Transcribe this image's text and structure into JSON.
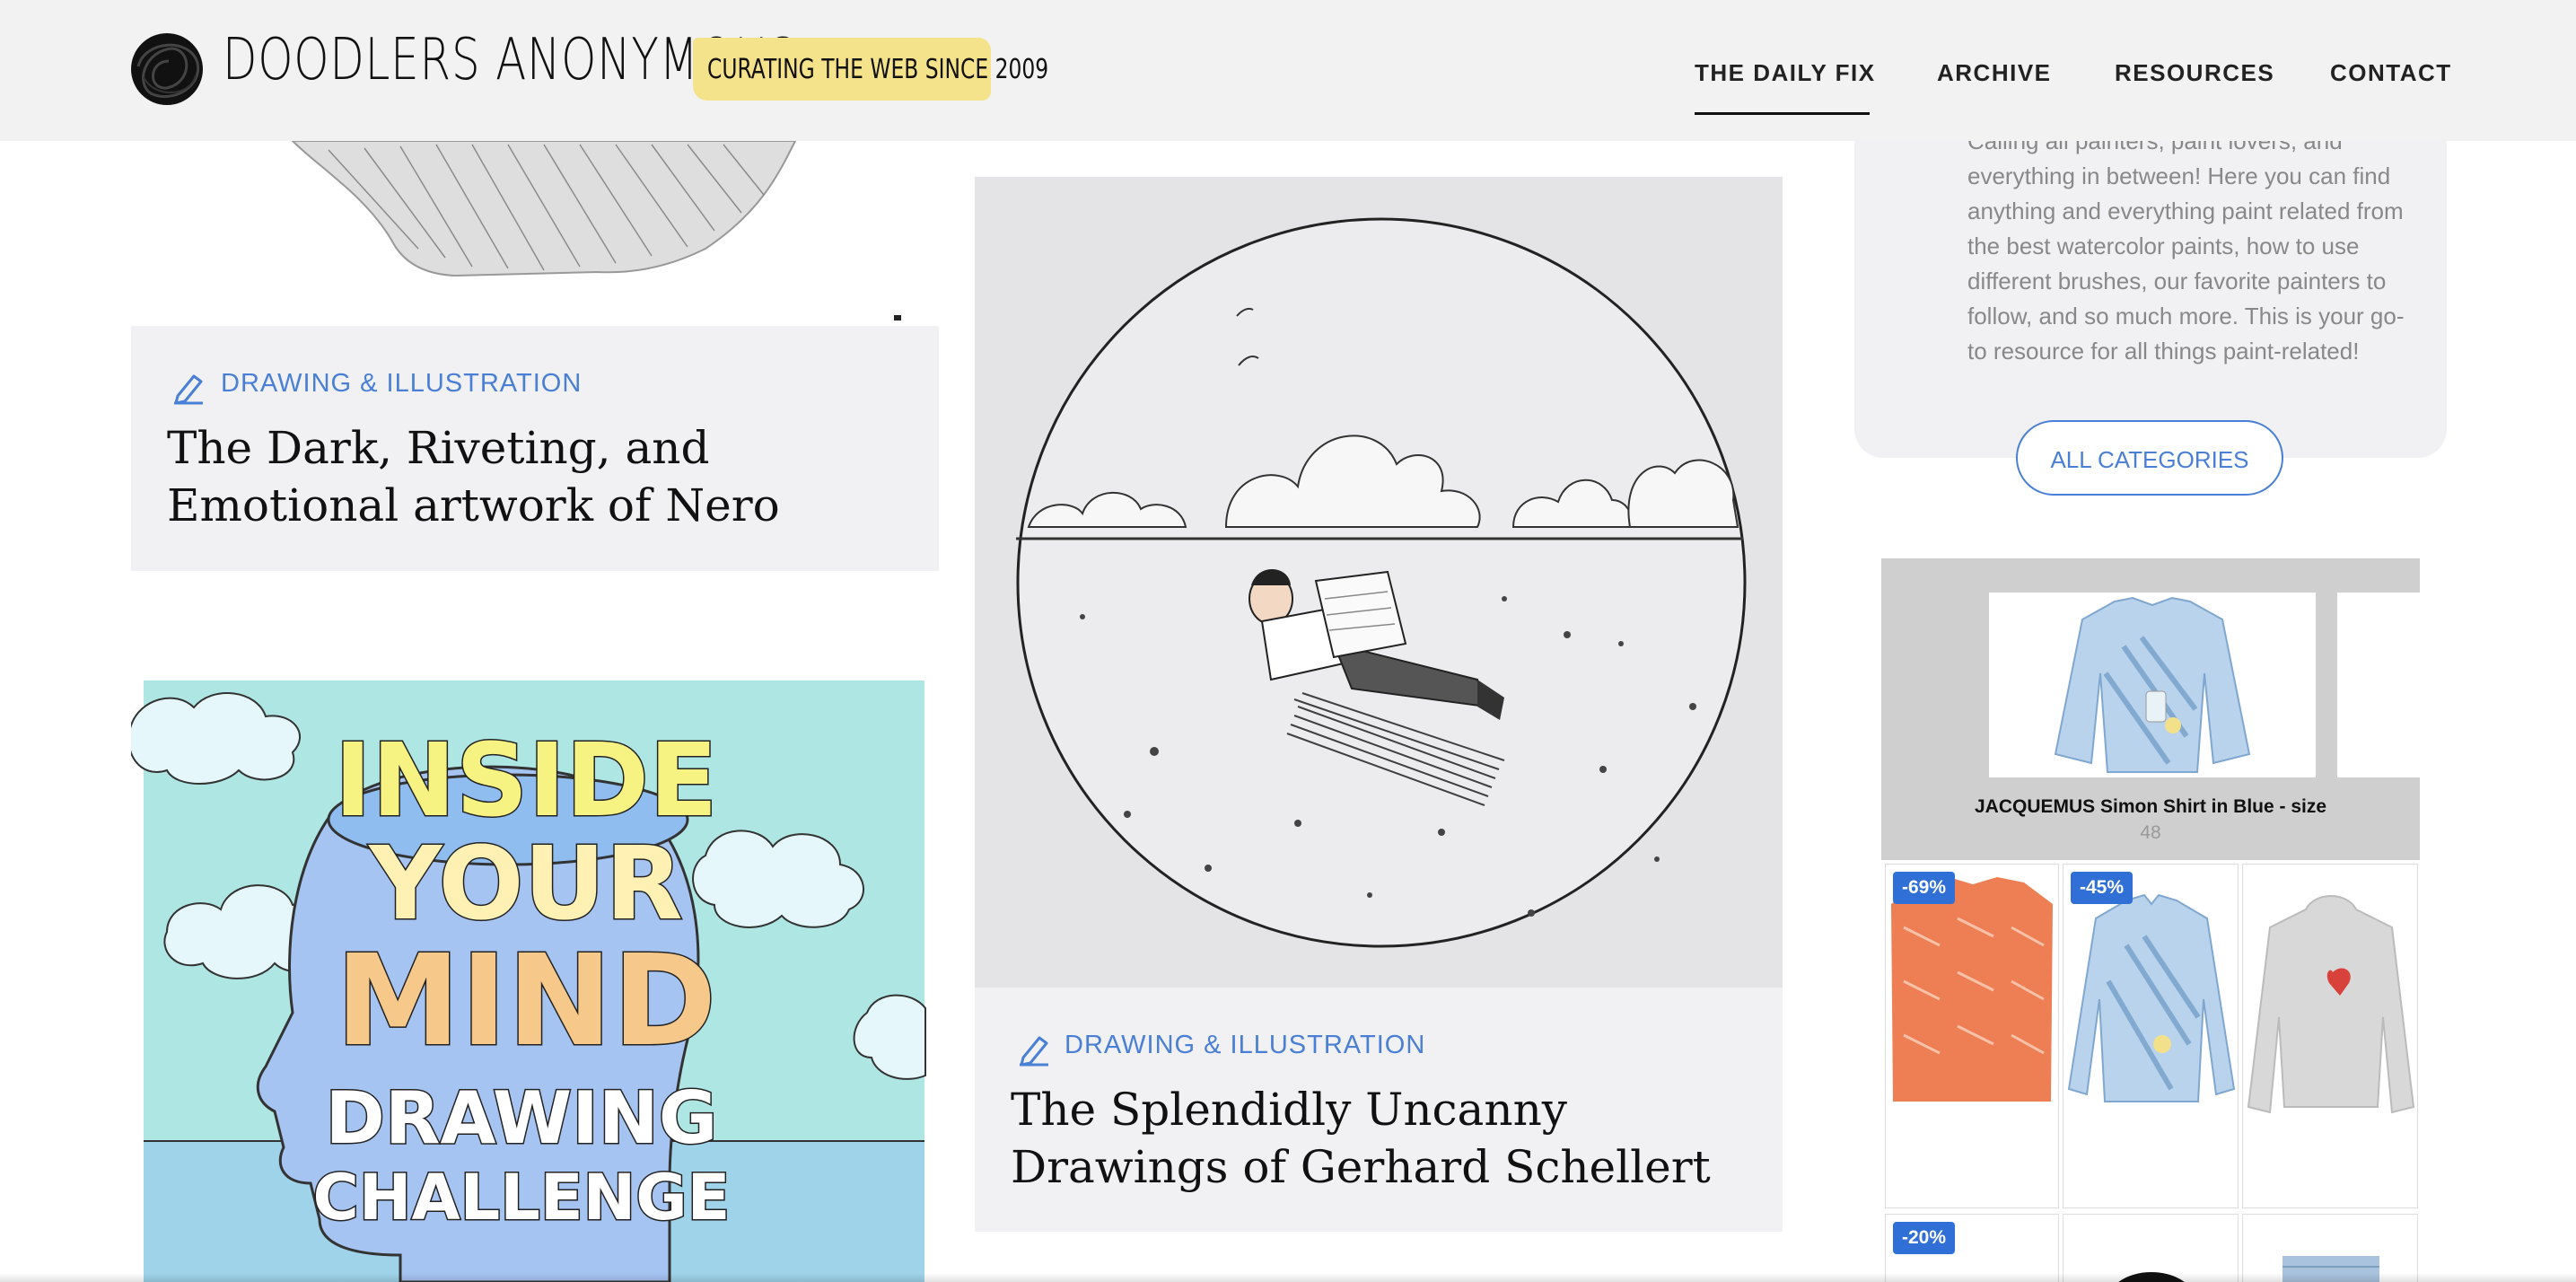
{
  "header": {
    "logo_text": "DOODLERS ANONYMOUS",
    "tagline": "CURATING THE WEB SINCE 2009",
    "nav": [
      {
        "label": "THE DAILY FIX",
        "active": true
      },
      {
        "label": "ARCHIVE"
      },
      {
        "label": "RESOURCES"
      },
      {
        "label": "CONTACT"
      }
    ]
  },
  "posts": [
    {
      "category": "DRAWING & ILLUSTRATION",
      "title": "The Dark, Riveting, and Emotional artwork of Nero"
    },
    {
      "category": "DRAWING & ILLUSTRATION",
      "title": "The Splendidly Uncanny Drawings of Gerhard Schellert"
    }
  ],
  "mind_poster": {
    "line1": "INSIDE",
    "line2": "YOUR",
    "line3": "MIND",
    "line4": "DRAWING",
    "line5": "CHALLENGE"
  },
  "sidebar": {
    "text": "Calling all painters, paint lovers, and everything in between! Here you can find anything and everything paint related from the best watercolor paints, how to use different brushes, our favorite painters to follow, and so much more. This is your go-to resource for all things paint-related!",
    "all_categories": "ALL CATEGORIES"
  },
  "ad": {
    "product_name": "JACQUEMUS Simon Shirt in Blue - size",
    "product_size": "48",
    "tiles": [
      {
        "badge": "-69%"
      },
      {
        "badge": "-45%"
      },
      {
        "badge": ""
      },
      {
        "badge": "-20%"
      },
      {
        "badge": ""
      },
      {
        "badge": ""
      }
    ]
  },
  "colors": {
    "accent_blue": "#4a7fd6",
    "tagline_yellow": "#f4e38a",
    "header_bg": "#f2f2f2",
    "card_bg": "#f1f1f3",
    "badge_blue": "#2f6fd6"
  }
}
